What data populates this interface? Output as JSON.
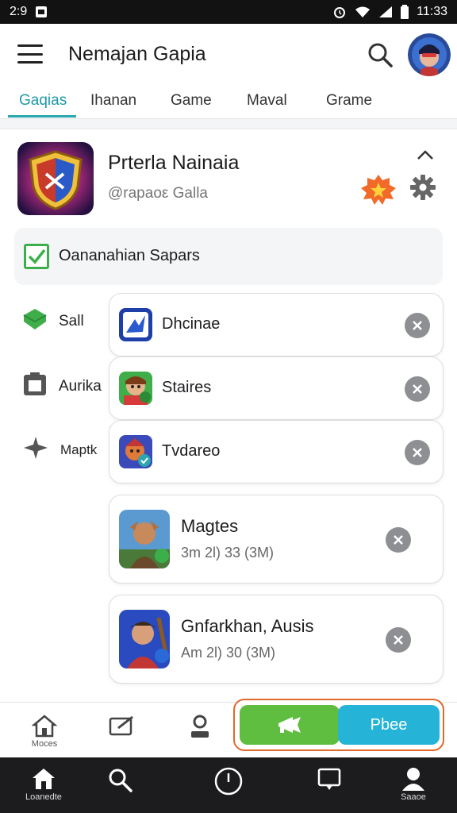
{
  "status_bar": {
    "time_left": "2:9",
    "time_right": "11:33"
  },
  "app_bar": {
    "title": "Nemajan Gapia",
    "tabs": [
      {
        "label": "Gaqias"
      },
      {
        "label": "Ihanan"
      },
      {
        "label": "Game"
      },
      {
        "label": "Maval"
      },
      {
        "label": "Grame"
      }
    ]
  },
  "profile": {
    "name": "Prterla Nainaia",
    "handle": "@rapaoε Galla"
  },
  "checkbox_row": {
    "label": "Oananahian Sapars"
  },
  "side_menu": [
    {
      "label": "Sall",
      "icon": "shield-icon"
    },
    {
      "label": "Aurika",
      "icon": "folder-icon"
    },
    {
      "label": "Maptk",
      "icon": "star-icon"
    }
  ],
  "games": [
    {
      "name": "Dhcinae",
      "meta": ""
    },
    {
      "name": "Staires",
      "meta": ""
    },
    {
      "name": "Tvdareo",
      "meta": ""
    },
    {
      "name": "Magtes",
      "meta": "3m 2l) 33 (3M)"
    },
    {
      "name": "Gnfarkhan, Ausis",
      "meta": "Am 2l) 30 (3M)"
    }
  ],
  "action_bar": {
    "home_label": "Moces",
    "blue_button_label": "Pbee"
  },
  "nav_bar": {
    "home_label": "Loanedte",
    "profile_label": "Saaoe"
  },
  "colors": {
    "accent_teal": "#1e9aa6",
    "green": "#5fbd3f",
    "blue": "#25b4d8",
    "orange_outline": "#e06a2b"
  }
}
